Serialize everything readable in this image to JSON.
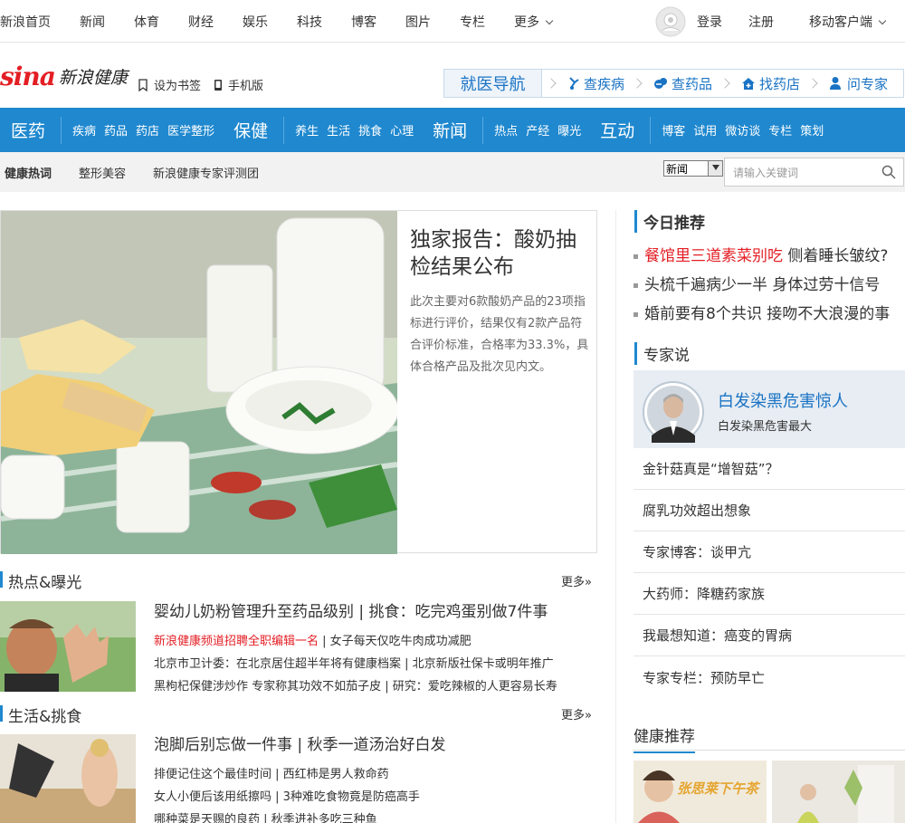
{
  "topnav": {
    "items": [
      "新浪首页",
      "新闻",
      "体育",
      "财经",
      "娱乐",
      "科技",
      "博客",
      "图片",
      "专栏",
      "更多"
    ],
    "login": "登录",
    "register": "注册",
    "mobile": "移动客户端"
  },
  "header": {
    "logo_text": "sina",
    "logo_sub": "新浪健康",
    "bookmark": "设为书签",
    "mobile_version": "手机版"
  },
  "guide": {
    "title": "就医导航",
    "items": [
      "查疾病",
      "查药品",
      "找药店",
      "问专家"
    ]
  },
  "mainnav": {
    "groups": [
      {
        "big": "医药",
        "small": [
          "疾病",
          "药品",
          "药店",
          "医学整形"
        ]
      },
      {
        "big": "保健",
        "small": [
          "养生",
          "生活",
          "挑食",
          "心理"
        ]
      },
      {
        "big": "新闻",
        "small": [
          "热点",
          "产经",
          "曝光"
        ]
      },
      {
        "big": "互动",
        "small": [
          "博客",
          "试用",
          "微访谈",
          "专栏",
          "策划"
        ]
      }
    ]
  },
  "tagbar": {
    "items": [
      "健康热词",
      "整形美容",
      "新浪健康专家评测团"
    ],
    "select_value": "新闻",
    "search_placeholder": "请输入关键词"
  },
  "hero": {
    "title": "独家报告：酸奶抽检结果公布",
    "desc": "此次主要对6款酸奶产品的23项指标进行评价，结果仅有2款产品符合评价标准，合格率为33.3%，具体合格产品及批次见内文。"
  },
  "hot": {
    "title": "热点&曝光",
    "more": "更多",
    "main": "婴幼儿奶粉管理升至药品级别 | 挑食：吃完鸡蛋别做7件事",
    "lines": [
      {
        "red": "新浪健康频道招聘全职编辑一名",
        "rest": " | 女子每天仅吃牛肉成功减肥"
      },
      {
        "red": "",
        "rest": "北京市卫计委：在北京居住超半年将有健康档案 | 北京新版社保卡或明年推广"
      },
      {
        "red": "",
        "rest": "黑枸杞保健涉炒作 专家称其功效不如茄子皮 | 研究：爱吃辣椒的人更容易长寿"
      }
    ]
  },
  "life": {
    "title": "生活&挑食",
    "more": "更多",
    "main": "泡脚后别忘做一件事 | 秋季一道汤治好白发",
    "lines": [
      "排便记住这个最佳时间 | 西红柿是男人救命药",
      "女人小便后该用纸擦吗 | 3种难吃食物竟是防癌高手",
      "哪种菜是天赐的良药 | 秋季进补多吃三种鱼"
    ]
  },
  "today": {
    "title": "今日推荐",
    "items": [
      {
        "red": "餐馆里三道素菜别吃",
        "rest": " 侧着睡长皱纹?"
      },
      {
        "red": "",
        "rest": "头梳千遍病少一半 身体过劳十信号"
      },
      {
        "red": "",
        "rest": "婚前要有8个共识 接吻不大浪漫的事"
      }
    ]
  },
  "expert": {
    "title": "专家说",
    "feature_title": "白发染黑危害惊人",
    "feature_sub": "白发染黑危害最大",
    "items": [
      "金针菇真是“增智菇”？",
      "腐乳功效超出想象",
      "专家博客：谈甲亢",
      "大药师：降糖药家族",
      "我最想知道：癌变的胃病",
      "专家专栏：预防早亡"
    ]
  },
  "recommend": {
    "title": "健康推荐",
    "promo_text": "张思莱下午茶"
  },
  "colors": {
    "brand_blue": "#1f88cf",
    "red": "#e31e24"
  }
}
